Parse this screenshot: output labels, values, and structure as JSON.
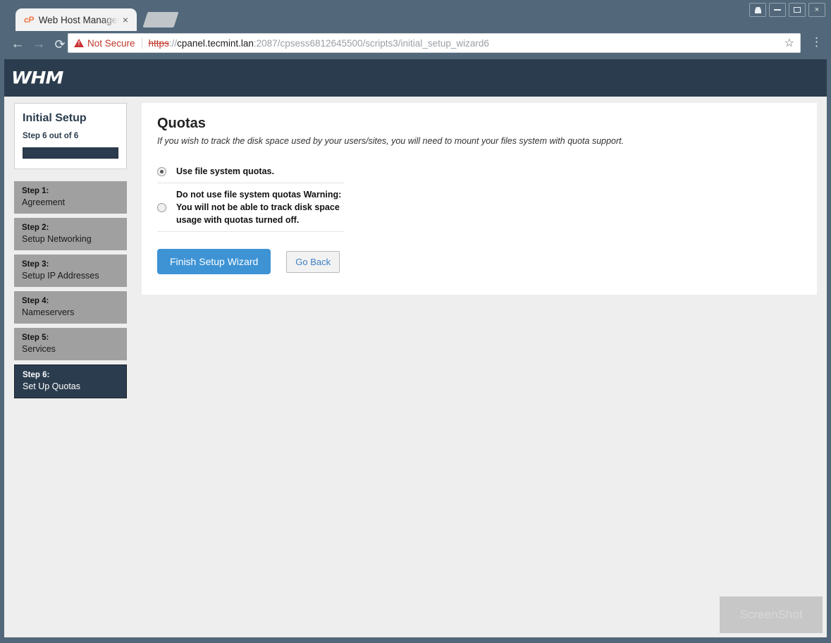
{
  "browser": {
    "tab": {
      "favicon_label": "cP",
      "title": "Web Host Manager",
      "close_label": "×"
    },
    "new_tab_name": "new-tab-button",
    "window_controls": [
      {
        "name": "account-button",
        "label": ""
      },
      {
        "name": "minimize-button",
        "label": ""
      },
      {
        "name": "maximize-button",
        "label": ""
      },
      {
        "name": "close-button",
        "label": "×"
      }
    ],
    "nav": {
      "back": "←",
      "forward": "→",
      "reload": "⟳",
      "menu": "⋮"
    },
    "omnibox": {
      "security_label": "Not Secure",
      "url_scheme": "https",
      "url_separator": "://",
      "url_host": "cpanel.tecmint.lan",
      "url_path": ":2087/cpsess6812645500/scripts3/initial_setup_wizard6",
      "bookmark_star": "☆"
    }
  },
  "header": {
    "logo_text": "WHM",
    "background": "#2b3c4e"
  },
  "sidebar": {
    "card": {
      "title": "Initial Setup",
      "step_counter": "Step 6 out of 6",
      "progress_percent": 100
    },
    "steps": [
      {
        "num": "Step 1:",
        "label": "Agreement",
        "active": false
      },
      {
        "num": "Step 2:",
        "label": "Setup Networking",
        "active": false
      },
      {
        "num": "Step 3:",
        "label": "Setup IP Addresses",
        "active": false
      },
      {
        "num": "Step 4:",
        "label": "Nameservers",
        "active": false
      },
      {
        "num": "Step 5:",
        "label": "Services",
        "active": false
      },
      {
        "num": "Step 6:",
        "label": "Set Up Quotas",
        "active": true
      }
    ]
  },
  "main": {
    "title": "Quotas",
    "description": "If you wish to track the disk space used by your users/sites, you will need to mount your files system with quota support.",
    "options": [
      {
        "label": "Use file system quotas.",
        "checked": true
      },
      {
        "label": "Do not use file system quotas Warning: You will not be able to track disk space usage with quotas turned off.",
        "checked": false
      }
    ],
    "buttons": {
      "finish": "Finish Setup Wizard",
      "back": "Go Back"
    }
  },
  "watermark": {
    "text": "ScreenShot"
  },
  "colors": {
    "chrome": "#52687a",
    "whm_navy": "#2b3c4e",
    "step_gray": "#a0a0a0",
    "primary_blue": "#3d93d4",
    "link_blue": "#3d7fc1",
    "danger_red": "#c0392b",
    "page_bg": "#eeeeee"
  }
}
